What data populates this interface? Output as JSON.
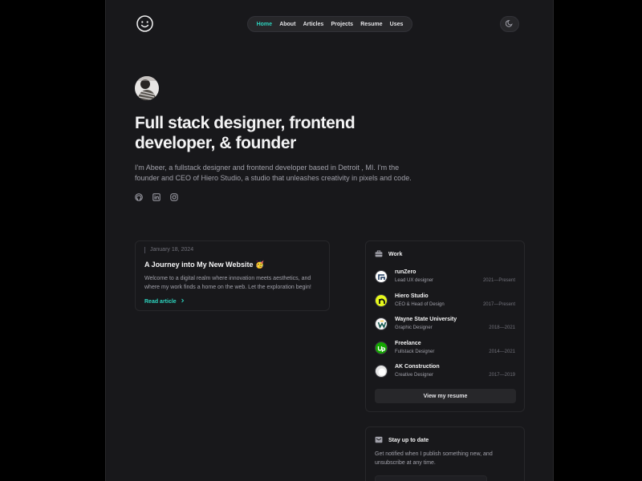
{
  "nav": {
    "items": [
      {
        "label": "Home",
        "active": true
      },
      {
        "label": "About"
      },
      {
        "label": "Articles"
      },
      {
        "label": "Projects"
      },
      {
        "label": "Resume"
      },
      {
        "label": "Uses"
      }
    ]
  },
  "hero": {
    "title": "Full stack designer, frontend developer, & founder",
    "bio": "I'm Abeer, a fullstack designer and frontend developer based in Detroit , MI. I'm the founder and CEO of Hiero Studio, a studio that unleashes creativity in pixels and code.",
    "socials": [
      "github-icon",
      "linkedin-icon",
      "instagram-icon"
    ]
  },
  "article": {
    "date": "January 18, 2024",
    "title": "A Journey into My New Website 🥳",
    "excerpt": "Welcome to a digital realm where innovation meets aesthetics, and where my work finds a home on the web. Let the exploration begin!",
    "read_more": "Read article"
  },
  "work": {
    "heading": "Work",
    "items": [
      {
        "company": "runZero",
        "role": "Lead UX designer",
        "dates": "2021—Present",
        "logo_color": "#ffffff"
      },
      {
        "company": "Hiero Studio",
        "role": "CEO & Head of Design",
        "dates": "2017—Present",
        "logo_color": "#e6f81c"
      },
      {
        "company": "Wayne State University",
        "role": "Graphic Designer",
        "dates": "2018—2021",
        "logo_color": "#f5f5f5"
      },
      {
        "company": "Freelance",
        "role": "Fullstack Designer",
        "dates": "2014—2021",
        "logo_color": "#14a800"
      },
      {
        "company": "AK Construction",
        "role": "Creative Designer",
        "dates": "2017—2019",
        "logo_color": "#e5e5e5"
      }
    ],
    "resume_button": "View my resume"
  },
  "newsletter": {
    "heading": "Stay up to date",
    "description": "Get notified when I publish something new, and unsubscribe at any time."
  },
  "colors": {
    "accent": "#2dd4bf",
    "background": "#18181b",
    "page_background": "#000000"
  }
}
